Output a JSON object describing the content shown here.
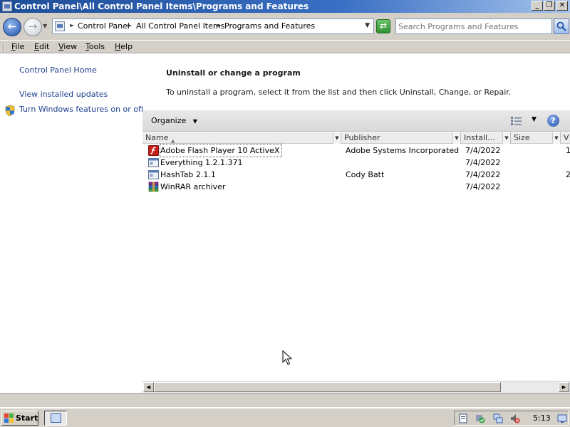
{
  "window": {
    "title": "Control Panel\\All Control Panel Items\\Programs and Features",
    "minimize_label": "_",
    "maximize_label": "❐",
    "close_label": "✕"
  },
  "address": {
    "crumbs": [
      "Control Panel",
      "All Control Panel Items",
      "Programs and Features"
    ],
    "search_placeholder": "Search Programs and Features"
  },
  "menu": [
    "File",
    "Edit",
    "View",
    "Tools",
    "Help"
  ],
  "sidebar": {
    "links": [
      {
        "label": "Control Panel Home"
      },
      {
        "label": "View installed updates"
      },
      {
        "label": "Turn Windows features on or off",
        "icon": "shield-icon"
      }
    ]
  },
  "main": {
    "heading": "Uninstall or change a program",
    "instructions": "To uninstall a program, select it from the list and then click Uninstall, Change, or Repair.",
    "organize_label": "Organize",
    "help_label": "?"
  },
  "table": {
    "columns": [
      "Name",
      "Publisher",
      "Install...",
      "Size",
      "V"
    ],
    "rows": [
      {
        "name": "Adobe Flash Player 10 ActiveX",
        "publisher": "Adobe Systems Incorporated",
        "installed": "7/4/2022",
        "extra": "1",
        "icon": "flash-icon",
        "selected": true
      },
      {
        "name": "Everything 1.2.1.371",
        "publisher": "",
        "installed": "7/4/2022",
        "extra": "",
        "icon": "program-icon"
      },
      {
        "name": "HashTab 2.1.1",
        "publisher": "Cody Batt",
        "installed": "7/4/2022",
        "extra": "2",
        "icon": "program-icon"
      },
      {
        "name": "WinRAR archiver",
        "publisher": "",
        "installed": "7/4/2022",
        "extra": "",
        "icon": "winrar-icon"
      }
    ]
  },
  "taskbar": {
    "start_label": "Start",
    "clock": "5:13"
  },
  "colors": {
    "titlebar": "#1f4e98",
    "link": "#1e3f8f",
    "chrome": "#d4d0c8"
  }
}
